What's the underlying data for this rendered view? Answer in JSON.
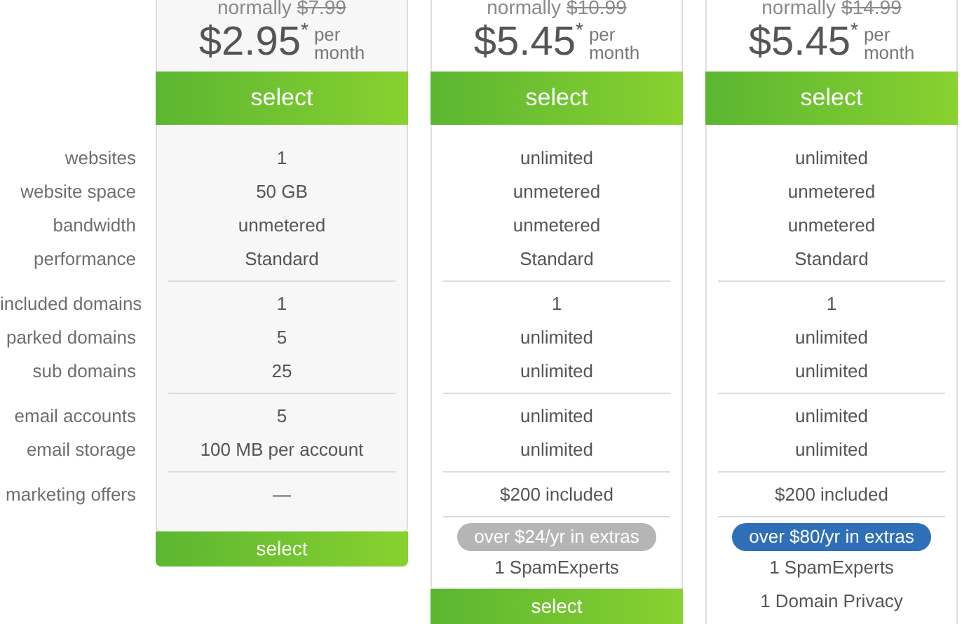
{
  "row_groups": [
    [
      "websites",
      "website space",
      "bandwidth",
      "performance"
    ],
    [
      "included domains",
      "parked domains",
      "sub domains"
    ],
    [
      "email accounts",
      "email storage"
    ],
    [
      "marketing offers"
    ]
  ],
  "plans": [
    {
      "normally": "normally",
      "old_price": "$7.99",
      "price": "$2.95",
      "mark": "*",
      "per": "per",
      "month": "month",
      "select": "select",
      "groups": [
        [
          "1",
          "50 GB",
          "unmetered",
          "Standard"
        ],
        [
          "1",
          "5",
          "25"
        ],
        [
          "5",
          "100 MB per account"
        ],
        [
          "—"
        ]
      ],
      "bottom_select": "select"
    },
    {
      "normally": "normally",
      "old_price": "$10.99",
      "price": "$5.45",
      "mark": "*",
      "per": "per",
      "month": "month",
      "select": "select",
      "groups": [
        [
          "unlimited",
          "unmetered",
          "unmetered",
          "Standard"
        ],
        [
          "1",
          "unlimited",
          "unlimited"
        ],
        [
          "unlimited",
          "unlimited"
        ],
        [
          "$200 included"
        ]
      ],
      "badge": {
        "text": "over $24/yr in extras",
        "color": "#b5b5b5"
      },
      "extras": [
        "1 SpamExperts"
      ],
      "bottom_select": "select"
    },
    {
      "normally": "normally",
      "old_price": "$14.99",
      "price": "$5.45",
      "mark": "*",
      "per": "per",
      "month": "month",
      "select": "select",
      "groups": [
        [
          "unlimited",
          "unmetered",
          "unmetered",
          "Standard"
        ],
        [
          "1",
          "unlimited",
          "unlimited"
        ],
        [
          "unlimited",
          "unlimited"
        ],
        [
          "$200 included"
        ]
      ],
      "badge": {
        "text": "over $80/yr in extras",
        "color": "#2f6fb7"
      },
      "extras": [
        "1 SpamExperts",
        "1 Domain Privacy"
      ]
    }
  ]
}
